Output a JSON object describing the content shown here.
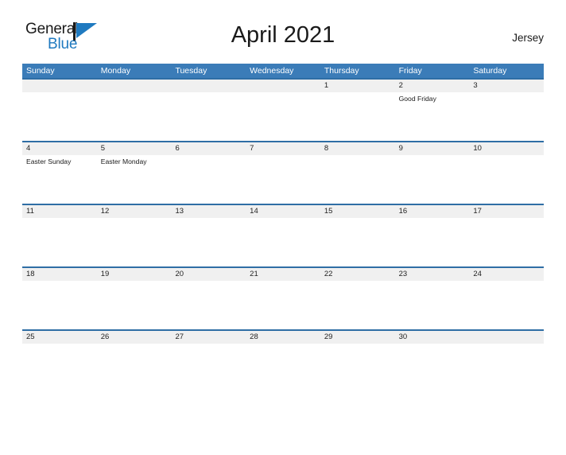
{
  "header": {
    "logo": {
      "word_one": "General",
      "word_two": "Blue",
      "flag_icon": "blue-flag-icon",
      "brand_color": "#1f7ac0"
    },
    "title": "April 2021",
    "region": "Jersey"
  },
  "theme": {
    "header_blue": "#3b7cb8",
    "rule_blue": "#2f6ea5",
    "band_gray": "#f0f0f0",
    "text_dark": "#1a1a1a"
  },
  "calendar": {
    "weekdays": [
      "Sunday",
      "Monday",
      "Tuesday",
      "Wednesday",
      "Thursday",
      "Friday",
      "Saturday"
    ],
    "weeks": [
      [
        {
          "day": "",
          "event": ""
        },
        {
          "day": "",
          "event": ""
        },
        {
          "day": "",
          "event": ""
        },
        {
          "day": "",
          "event": ""
        },
        {
          "day": "1",
          "event": ""
        },
        {
          "day": "2",
          "event": "Good Friday"
        },
        {
          "day": "3",
          "event": ""
        }
      ],
      [
        {
          "day": "4",
          "event": "Easter Sunday"
        },
        {
          "day": "5",
          "event": "Easter Monday"
        },
        {
          "day": "6",
          "event": ""
        },
        {
          "day": "7",
          "event": ""
        },
        {
          "day": "8",
          "event": ""
        },
        {
          "day": "9",
          "event": ""
        },
        {
          "day": "10",
          "event": ""
        }
      ],
      [
        {
          "day": "11",
          "event": ""
        },
        {
          "day": "12",
          "event": ""
        },
        {
          "day": "13",
          "event": ""
        },
        {
          "day": "14",
          "event": ""
        },
        {
          "day": "15",
          "event": ""
        },
        {
          "day": "16",
          "event": ""
        },
        {
          "day": "17",
          "event": ""
        }
      ],
      [
        {
          "day": "18",
          "event": ""
        },
        {
          "day": "19",
          "event": ""
        },
        {
          "day": "20",
          "event": ""
        },
        {
          "day": "21",
          "event": ""
        },
        {
          "day": "22",
          "event": ""
        },
        {
          "day": "23",
          "event": ""
        },
        {
          "day": "24",
          "event": ""
        }
      ],
      [
        {
          "day": "25",
          "event": ""
        },
        {
          "day": "26",
          "event": ""
        },
        {
          "day": "27",
          "event": ""
        },
        {
          "day": "28",
          "event": ""
        },
        {
          "day": "29",
          "event": ""
        },
        {
          "day": "30",
          "event": ""
        },
        {
          "day": "",
          "event": ""
        }
      ]
    ]
  }
}
